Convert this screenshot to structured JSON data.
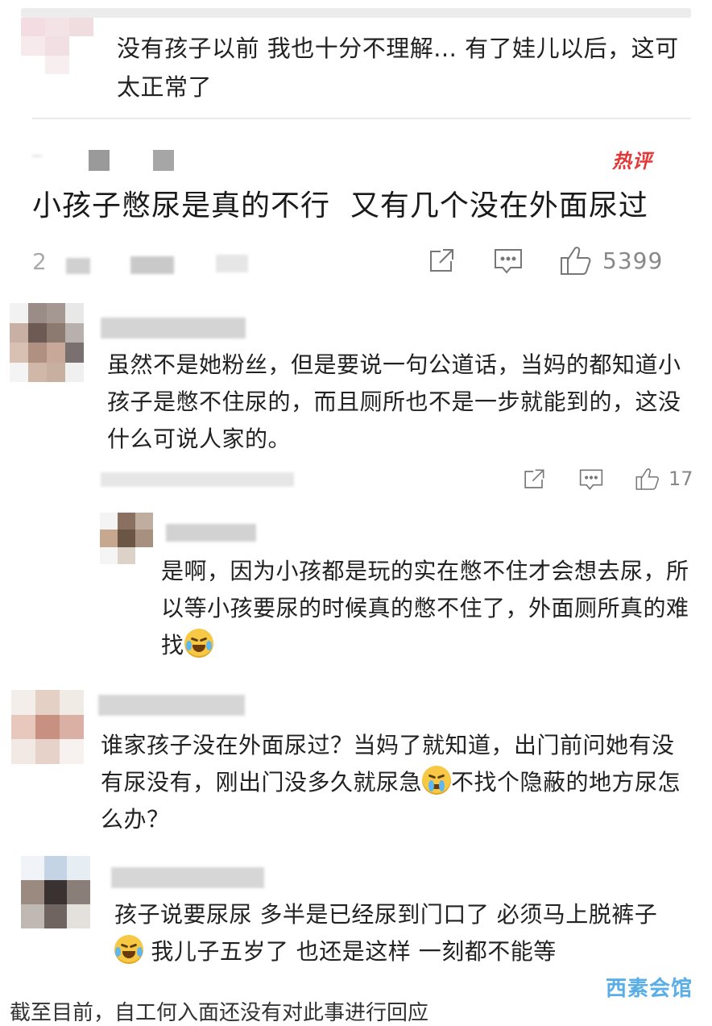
{
  "top_comment": {
    "text": "没有孩子以前 我也十分不理解... 有了娃儿以后，这可太正常了"
  },
  "hot_comment": {
    "badge": "热评",
    "text": "小孩子憋尿是真的不行  又有几个没在外面尿过",
    "meta_prefix": "2",
    "likes": "5399"
  },
  "comments": [
    {
      "text": "虽然不是她粉丝，但是要说一句公道话，当妈的都知道小孩子是憋不住尿的，而且厕所也不是一步就能到的，这没什么可说人家的。",
      "likes": "17"
    },
    {
      "text": "是啊，因为小孩都是玩的实在憋不住才会想去尿，所以等小孩要尿的时候真的憋不住了，外面厕所真的难找",
      "emoji": "crying-laughing-emoji"
    },
    {
      "text_a": "谁家孩子没在外面尿过？当妈了就知道，出门前问她有没有尿没有，刚出门没多久就尿急",
      "text_b": "不找个隐蔽的地方尿怎么办？",
      "emoji": "crying-emoji"
    },
    {
      "text_a": "孩子说要尿尿 多半是已经尿到门口了 必须马上脱裤子",
      "text_b": "我儿子五岁了 也还是这样 一刻都不能等",
      "emoji": "laughing-tears-emoji"
    }
  ],
  "watermark": "西素会馆",
  "bottom_partial": "截至目前，自工何入面还没有对此事进行回应"
}
